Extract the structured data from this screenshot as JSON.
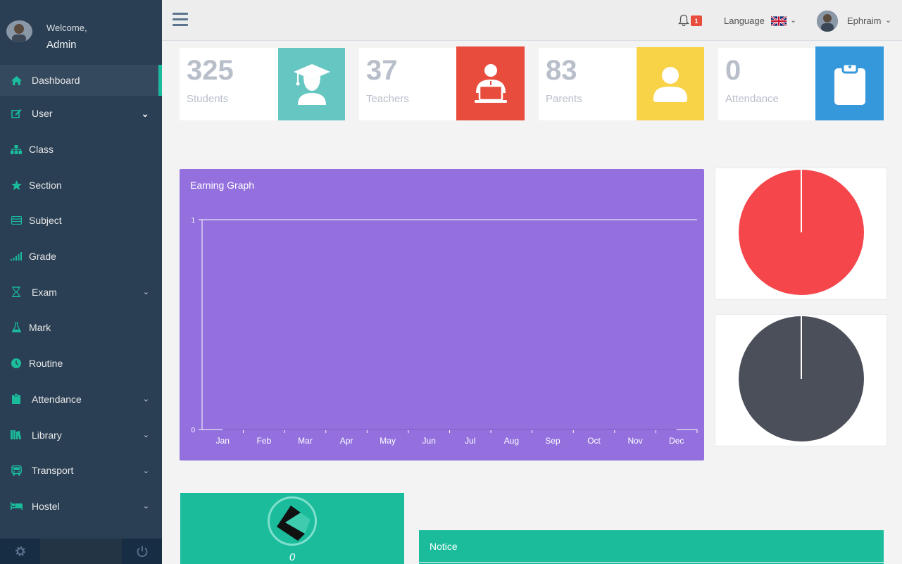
{
  "sidebar": {
    "welcome": "Welcome,",
    "user": "Admin",
    "items": [
      {
        "label": "Dashboard",
        "icon": "home-icon",
        "expandable": false
      },
      {
        "label": "User",
        "icon": "edit-icon",
        "expandable": true
      },
      {
        "label": "Class",
        "icon": "sitemap-icon",
        "expandable": false
      },
      {
        "label": "Section",
        "icon": "star-icon",
        "expandable": false
      },
      {
        "label": "Subject",
        "icon": "book-icon",
        "expandable": false
      },
      {
        "label": "Grade",
        "icon": "signal-icon",
        "expandable": false
      },
      {
        "label": "Exam",
        "icon": "hourglass-icon",
        "expandable": true
      },
      {
        "label": "Mark",
        "icon": "flask-icon",
        "expandable": false
      },
      {
        "label": "Routine",
        "icon": "clock-icon",
        "expandable": false
      },
      {
        "label": "Attendance",
        "icon": "clipboard-icon",
        "expandable": true
      },
      {
        "label": "Library",
        "icon": "library-icon",
        "expandable": true
      },
      {
        "label": "Transport",
        "icon": "bus-icon",
        "expandable": true
      },
      {
        "label": "Hostel",
        "icon": "bed-icon",
        "expandable": true
      }
    ],
    "footer": {
      "settings_icon": "gear-icon",
      "logout_icon": "power-icon"
    }
  },
  "topnav": {
    "notification_count": "1",
    "language_label": "Language",
    "user_name": "Ephraim"
  },
  "stats": [
    {
      "value": "325",
      "label": "Students",
      "color": "#66c6c1",
      "icon": "graduate-icon"
    },
    {
      "value": "37",
      "label": "Teachers",
      "color": "#e74c3c",
      "icon": "teacher-icon"
    },
    {
      "value": "83",
      "label": "Parents",
      "color": "#f8d347",
      "icon": "user-icon"
    },
    {
      "value": "0",
      "label": "Attendance",
      "color": "#3498db",
      "icon": "clipboard-icon"
    }
  ],
  "earning": {
    "title": "Earning Graph"
  },
  "chart_data": {
    "type": "line",
    "title": "Earning Graph",
    "categories": [
      "Jan",
      "Feb",
      "Mar",
      "Apr",
      "May",
      "Jun",
      "Jul",
      "Aug",
      "Sep",
      "Oct",
      "Nov",
      "Dec"
    ],
    "series": [
      {
        "values": [
          0,
          0,
          0,
          0,
          0,
          0,
          0,
          0,
          0,
          0,
          0,
          0
        ]
      }
    ],
    "yticks": [
      "0",
      "1"
    ],
    "ylim": [
      0,
      1
    ],
    "grid": false
  },
  "pies": [
    {
      "color": "#f4464b"
    },
    {
      "color": "#4a4f5a"
    }
  ],
  "bottom": {
    "counter": "0",
    "notice_title": "Notice"
  }
}
